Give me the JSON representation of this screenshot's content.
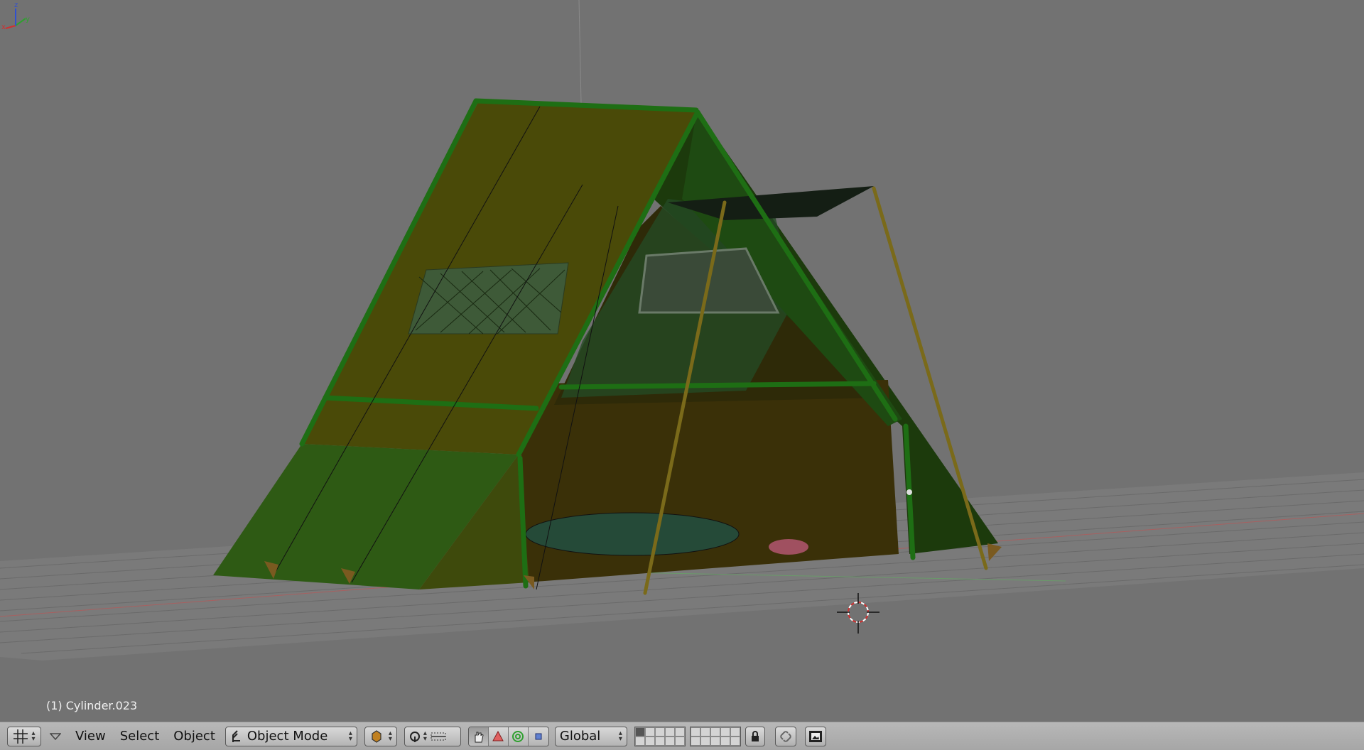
{
  "viewport": {
    "object_info": "(1) Cylinder.023",
    "axis_labels": {
      "x": "x",
      "y": "y",
      "z": "z"
    }
  },
  "header": {
    "editor_type_icon": "grid-icon",
    "menus": [
      "View",
      "Select",
      "Object"
    ],
    "mode": "Object Mode",
    "orientation": "Global"
  },
  "colors": {
    "background": "#727272",
    "tent_canvas": "#3a5a14",
    "tent_pole": "#1e6e14",
    "header": "#b0b0b0"
  }
}
